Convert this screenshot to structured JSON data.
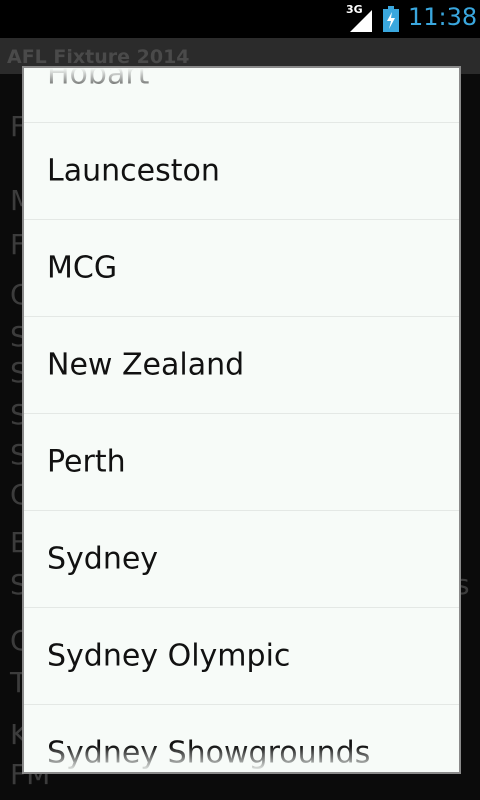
{
  "status_bar": {
    "network": "3G",
    "time": "11:38",
    "time_color": "#3aa7de",
    "battery_color": "#3aa7de"
  },
  "background_app": {
    "title": "AFL Fixture 2014",
    "rows": [
      {
        "lead": "F",
        "tail": ""
      },
      {
        "lead": "M",
        "tail": ""
      },
      {
        "lead": "F",
        "tail": ""
      },
      {
        "lead": "C",
        "tail": ""
      },
      {
        "lead": "S",
        "tail": ""
      },
      {
        "lead": "S",
        "tail": ""
      },
      {
        "lead": "S",
        "tail": ""
      },
      {
        "lead": "S",
        "tail": ""
      },
      {
        "lead": "C",
        "tail": ""
      },
      {
        "lead": "E",
        "tail": ""
      },
      {
        "lead": "S",
        "tail": "s"
      },
      {
        "lead": "C",
        "tail": ""
      },
      {
        "lead": "T",
        "tail": ""
      },
      {
        "lead": "K",
        "tail": ""
      },
      {
        "lead": "FM",
        "tail": ""
      }
    ]
  },
  "dialog": {
    "items": [
      "Hobart",
      "Launceston",
      "MCG",
      "New Zealand",
      "Perth",
      "Sydney",
      "Sydney Olympic",
      "Sydney Showgrounds"
    ]
  }
}
